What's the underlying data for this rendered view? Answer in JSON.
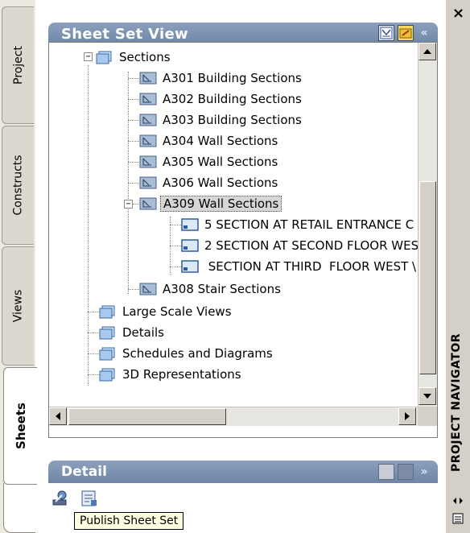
{
  "window": {
    "palette_title": "PROJECT NAVIGATOR",
    "close_glyph": "×"
  },
  "side_tabs": [
    {
      "label": "Project"
    },
    {
      "label": "Constructs"
    },
    {
      "label": "Views"
    },
    {
      "label": "Sheets"
    }
  ],
  "sheet_set_view": {
    "title": "Sheet Set View",
    "collapse_glyph": "«"
  },
  "tree": {
    "root": {
      "label": "Sections",
      "expander": "−"
    },
    "sheets": [
      {
        "label": "A301 Building Sections"
      },
      {
        "label": "A302 Building Sections"
      },
      {
        "label": "A303 Building Sections"
      },
      {
        "label": "A304 Wall Sections"
      },
      {
        "label": "A305 Wall Sections"
      },
      {
        "label": "A306 Wall Sections"
      },
      {
        "label": "A309 Wall Sections",
        "expander": "−"
      }
    ],
    "views": [
      {
        "label": "5 SECTION AT RETAIL ENTRANCE C"
      },
      {
        "label": "2 SECTION AT SECOND FLOOR WES"
      },
      {
        "label": " SECTION AT THIRD  FLOOR WEST \\"
      }
    ],
    "after": [
      {
        "label": "A308 Stair Sections"
      }
    ],
    "groups": [
      {
        "label": "Large Scale Views"
      },
      {
        "label": "Details"
      },
      {
        "label": "Schedules and Diagrams"
      },
      {
        "label": "3D Representations"
      }
    ]
  },
  "detail": {
    "title": "Detail",
    "collapse_glyph": "»"
  },
  "tooltip": {
    "text": "Publish Sheet Set"
  },
  "icons": {
    "folder": "sheet-set-folder-icon",
    "sheet": "sheet-icon",
    "view": "view-icon",
    "publish": "publish-icon",
    "publish_settings": "publish-settings-icon"
  },
  "colors": {
    "header": "#7b90ad",
    "tooltip": "#ffffe1",
    "selection": "#d6d6d6"
  }
}
